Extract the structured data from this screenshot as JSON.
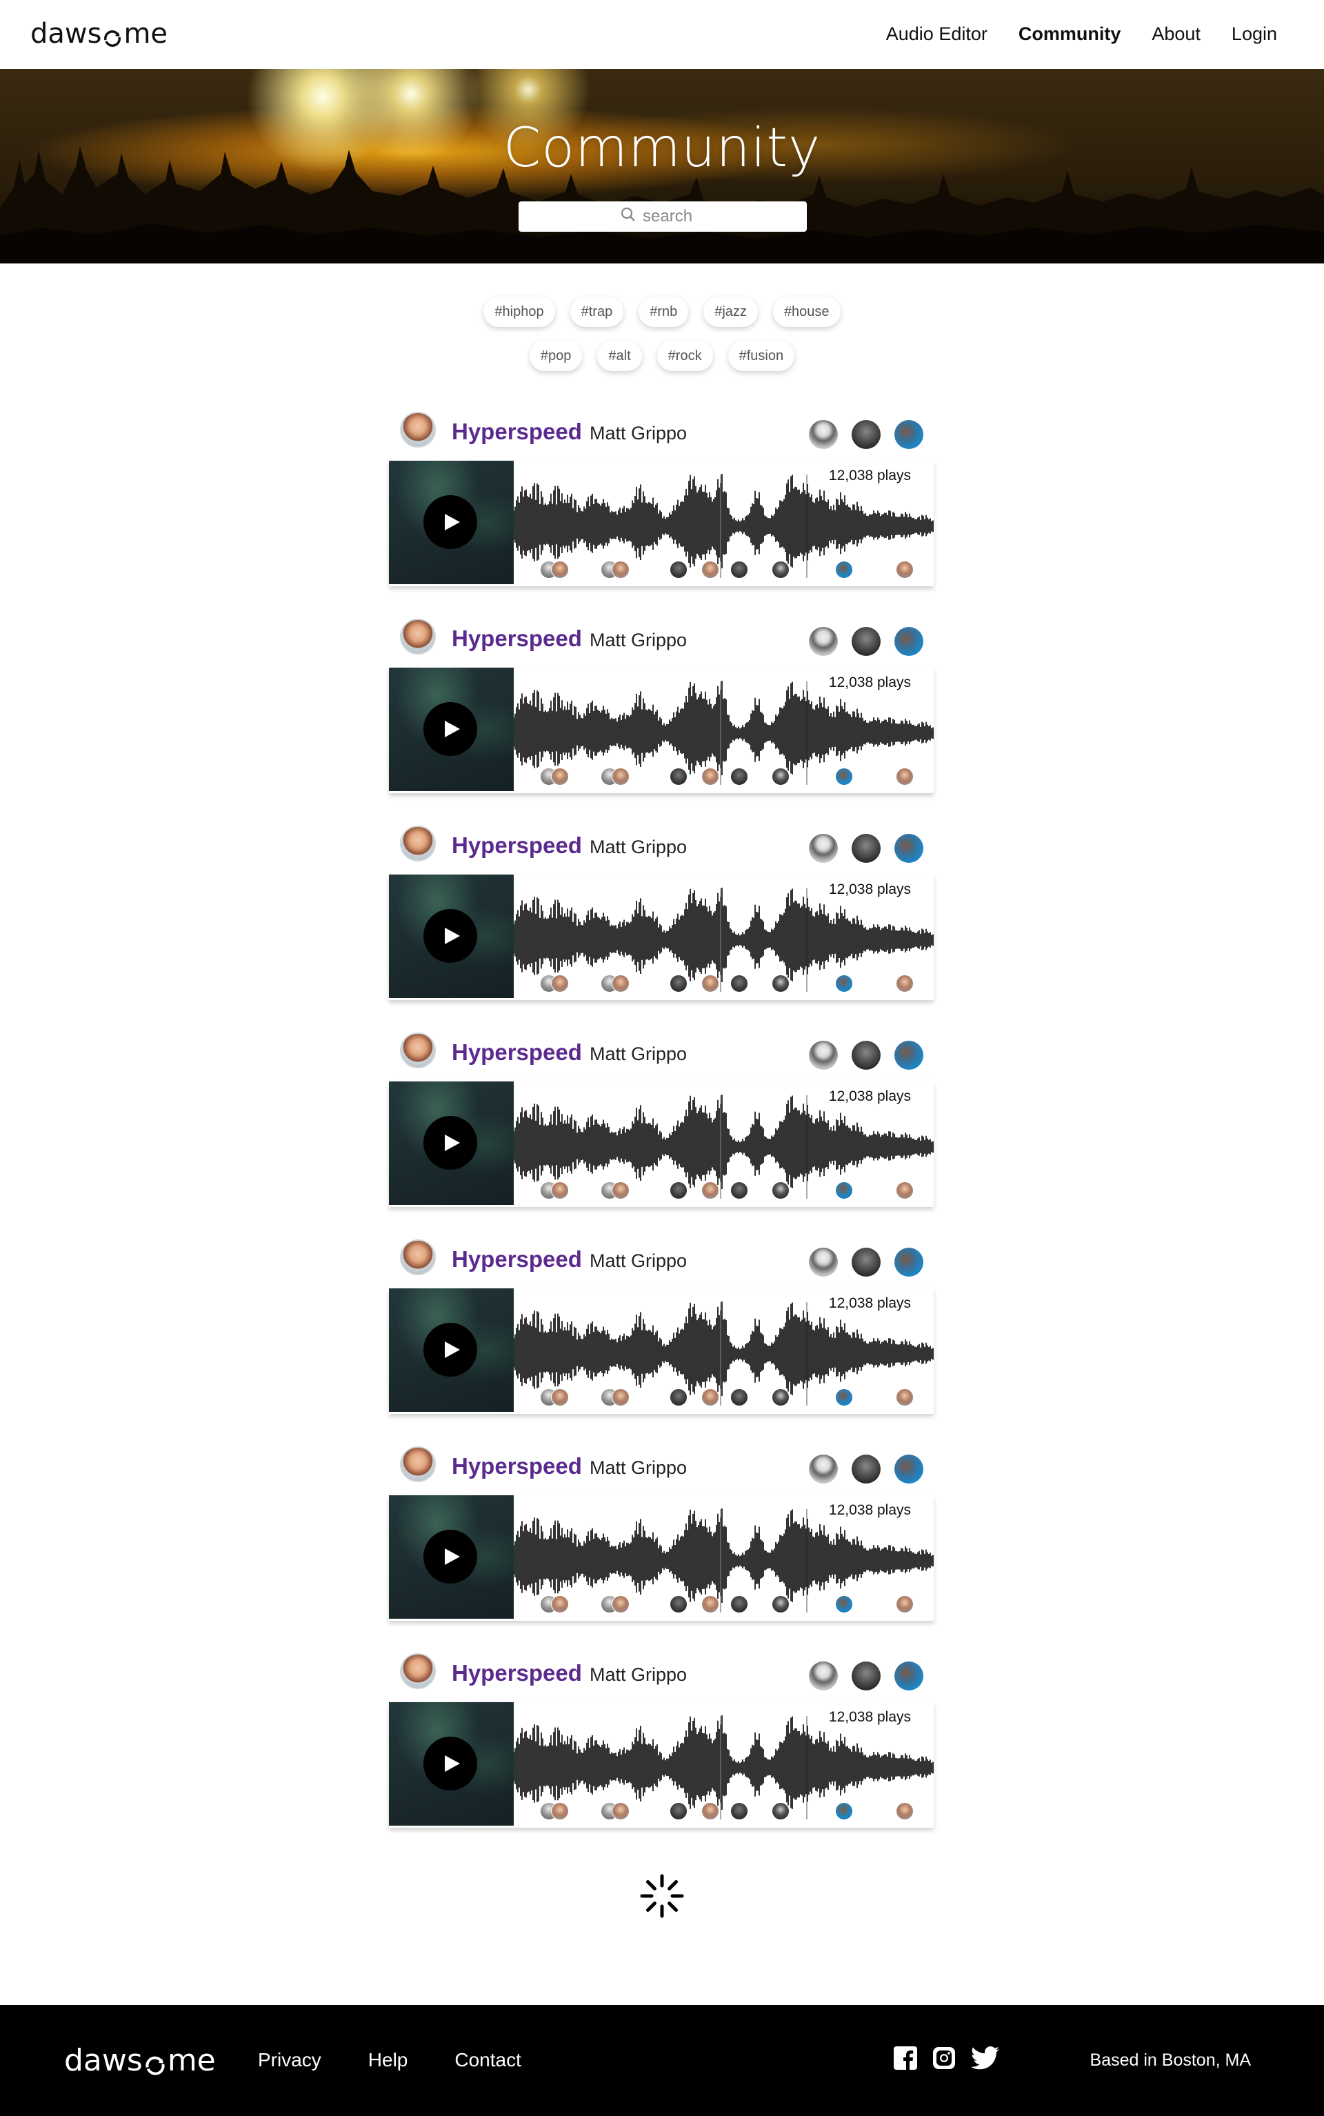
{
  "nav": {
    "logo": "dawsome",
    "links": [
      "Audio Editor",
      "Community",
      "About",
      "Login"
    ],
    "active": "Community"
  },
  "hero": {
    "title": "Community",
    "search_placeholder": "search"
  },
  "tags": {
    "row1": [
      "#hiphop",
      "#trap",
      "#rnb",
      "#jazz",
      "#house"
    ],
    "row2": [
      "#pop",
      "#alt",
      "#rock",
      "#fusion"
    ]
  },
  "tracks": [
    {
      "title": "Hyperspeed",
      "artist": "Matt Grippo",
      "plays": "12,038 plays"
    },
    {
      "title": "Hyperspeed",
      "artist": "Matt Grippo",
      "plays": "12,038 plays"
    },
    {
      "title": "Hyperspeed",
      "artist": "Matt Grippo",
      "plays": "12,038 plays"
    },
    {
      "title": "Hyperspeed",
      "artist": "Matt Grippo",
      "plays": "12,038 plays"
    },
    {
      "title": "Hyperspeed",
      "artist": "Matt Grippo",
      "plays": "12,038 plays"
    },
    {
      "title": "Hyperspeed",
      "artist": "Matt Grippo",
      "plays": "12,038 plays"
    },
    {
      "title": "Hyperspeed",
      "artist": "Matt Grippo",
      "plays": "12,038 plays"
    }
  ],
  "footer": {
    "logo": "dawsome",
    "links": [
      "Privacy",
      "Help",
      "Contact"
    ],
    "social_icons": [
      "facebook-icon",
      "instagram-icon",
      "twitter-icon"
    ],
    "location": "Based in Boston, MA"
  },
  "colors": {
    "track_title": "#5b2a8f",
    "footer_bg": "#000000",
    "hero_accent": "#f0aa14"
  }
}
